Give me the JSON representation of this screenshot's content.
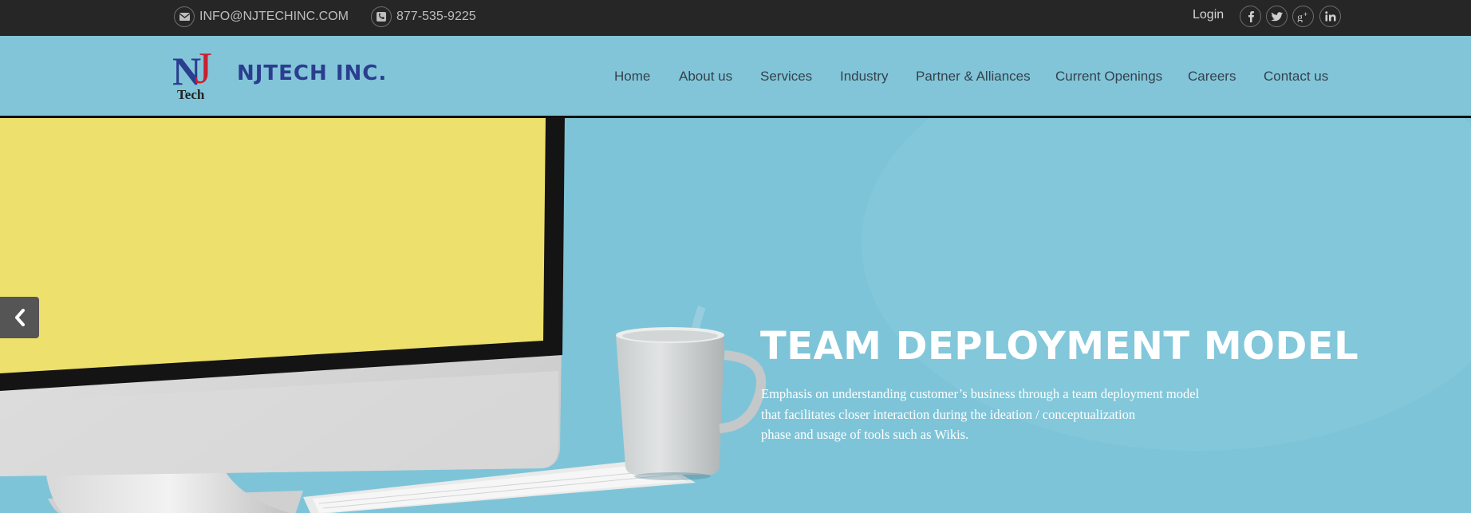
{
  "topbar": {
    "email": "INFO@NJTECHINC.COM",
    "phone": "877-535-9225",
    "login_label": "Login",
    "social_icons": [
      "facebook-icon",
      "twitter-icon",
      "google-plus-icon",
      "linkedin-icon"
    ]
  },
  "logo": {
    "mark_letters": "NJ",
    "mark_sub": "Tech",
    "company_name": "NJTECH INC."
  },
  "nav": {
    "items": [
      "Home",
      "About us",
      "Services",
      "Industry",
      "Partner & Alliances",
      "Current Openings",
      "Careers",
      "Contact us"
    ]
  },
  "hero": {
    "title": "TEAM DEPLOYMENT MODEL",
    "lines": [
      "Emphasis on understanding customer’s business through a team deployment model",
      "that facilitates closer interaction during the ideation / conceptualization",
      "phase and usage of tools such as Wikis."
    ]
  },
  "colors": {
    "topbar_bg": "#262626",
    "header_bg": "#82c5d9",
    "hero_bg": "#7ec4d8",
    "screen_yellow": "#ede06d",
    "logo_blue": "#2b3d8f",
    "logo_red": "#c8202e"
  }
}
